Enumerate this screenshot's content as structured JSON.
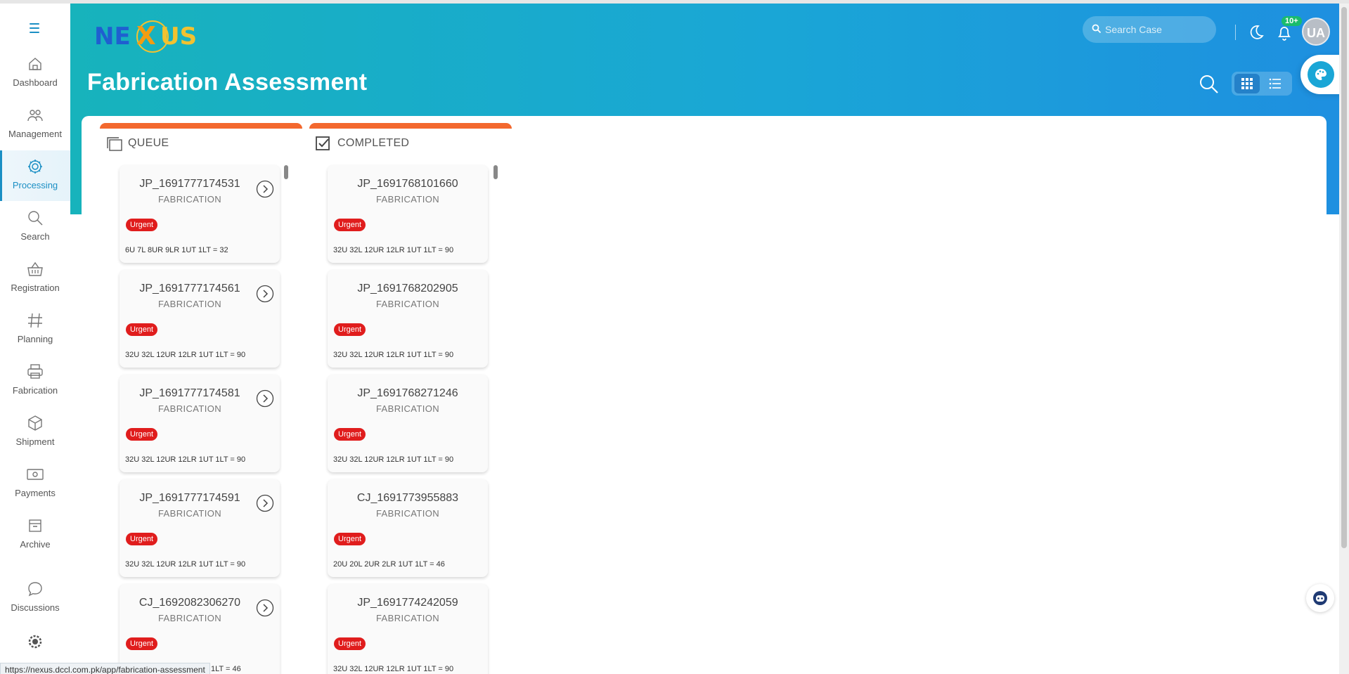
{
  "app": {
    "logo_text": "NEXUS"
  },
  "sidebar": {
    "items": [
      {
        "label": "Dashboard",
        "icon": "home-icon"
      },
      {
        "label": "Management",
        "icon": "users-icon"
      },
      {
        "label": "Processing",
        "icon": "gear-icon",
        "active": true
      },
      {
        "label": "Search",
        "icon": "search-icon"
      },
      {
        "label": "Registration",
        "icon": "basket-icon"
      },
      {
        "label": "Planning",
        "icon": "hash-icon"
      },
      {
        "label": "Fabrication",
        "icon": "printer-icon"
      },
      {
        "label": "Shipment",
        "icon": "box-icon"
      },
      {
        "label": "Payments",
        "icon": "cash-icon"
      },
      {
        "label": "Archive",
        "icon": "archive-icon"
      },
      {
        "label": "Discussions",
        "icon": "chat-icon"
      }
    ]
  },
  "header": {
    "page_title": "Fabrication Assessment",
    "search_placeholder": "Search Case",
    "notifications_badge": "10+",
    "avatar_initials": "UA"
  },
  "columns": {
    "queue": {
      "title": "QUEUE",
      "cards": [
        {
          "id": "JP_1691777174531",
          "type": "FABRICATION",
          "priority": "Urgent",
          "units": "6U 7L 8UR 9LR 1UT 1LT = 32"
        },
        {
          "id": "JP_1691777174561",
          "type": "FABRICATION",
          "priority": "Urgent",
          "units": "32U 32L 12UR 12LR 1UT 1LT = 90"
        },
        {
          "id": "JP_1691777174581",
          "type": "FABRICATION",
          "priority": "Urgent",
          "units": "32U 32L 12UR 12LR 1UT 1LT = 90"
        },
        {
          "id": "JP_1691777174591",
          "type": "FABRICATION",
          "priority": "Urgent",
          "units": "32U 32L 12UR 12LR 1UT 1LT = 90"
        },
        {
          "id": "CJ_1692082306270",
          "type": "FABRICATION",
          "priority": "Urgent",
          "units": "1LT = 46"
        }
      ]
    },
    "completed": {
      "title": "COMPLETED",
      "cards": [
        {
          "id": "JP_1691768101660",
          "type": "FABRICATION",
          "priority": "Urgent",
          "units": "32U 32L 12UR 12LR 1UT 1LT = 90"
        },
        {
          "id": "JP_1691768202905",
          "type": "FABRICATION",
          "priority": "Urgent",
          "units": "32U 32L 12UR 12LR 1UT 1LT = 90"
        },
        {
          "id": "JP_1691768271246",
          "type": "FABRICATION",
          "priority": "Urgent",
          "units": "32U 32L 12UR 12LR 1UT 1LT = 90"
        },
        {
          "id": "CJ_1691773955883",
          "type": "FABRICATION",
          "priority": "Urgent",
          "units": "20U 20L 2UR 2LR 1UT 1LT = 46"
        },
        {
          "id": "JP_1691774242059",
          "type": "FABRICATION",
          "priority": "Urgent",
          "units": "32U 32L 12UR 12LR 1UT 1LT = 90"
        }
      ]
    }
  },
  "statusbar": {
    "url": "https://nexus.dccl.com.pk/app/fabrication-assessment"
  },
  "colors": {
    "accent": "#1b8fc4",
    "column_top": "#f3682e",
    "urgent": "#e01d1d",
    "badge": "#1abc6c"
  }
}
